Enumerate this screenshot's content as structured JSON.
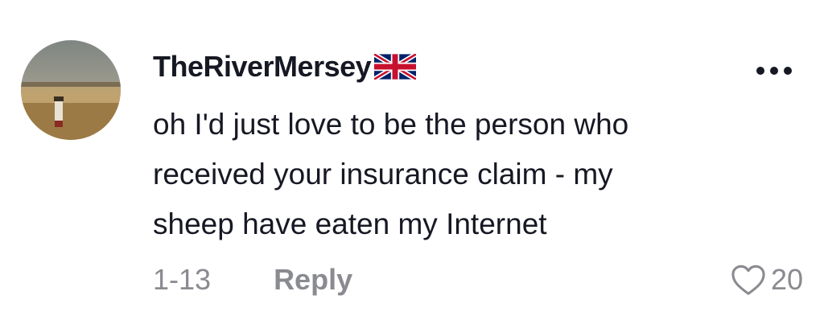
{
  "comment": {
    "username": "TheRiverMersey",
    "flag_icon": "united-kingdom-flag-icon",
    "more_icon": "more-horizontal-icon",
    "text": "oh I'd just love to be the person who\nreceived your insurance claim - my\nsheep have eaten my Internet",
    "date": "1-13",
    "reply_label": "Reply",
    "like_icon": "heart-outline-icon",
    "like_count": "20"
  },
  "colors": {
    "text_primary": "#161823",
    "text_secondary": "#8a8b91",
    "background": "#ffffff"
  }
}
